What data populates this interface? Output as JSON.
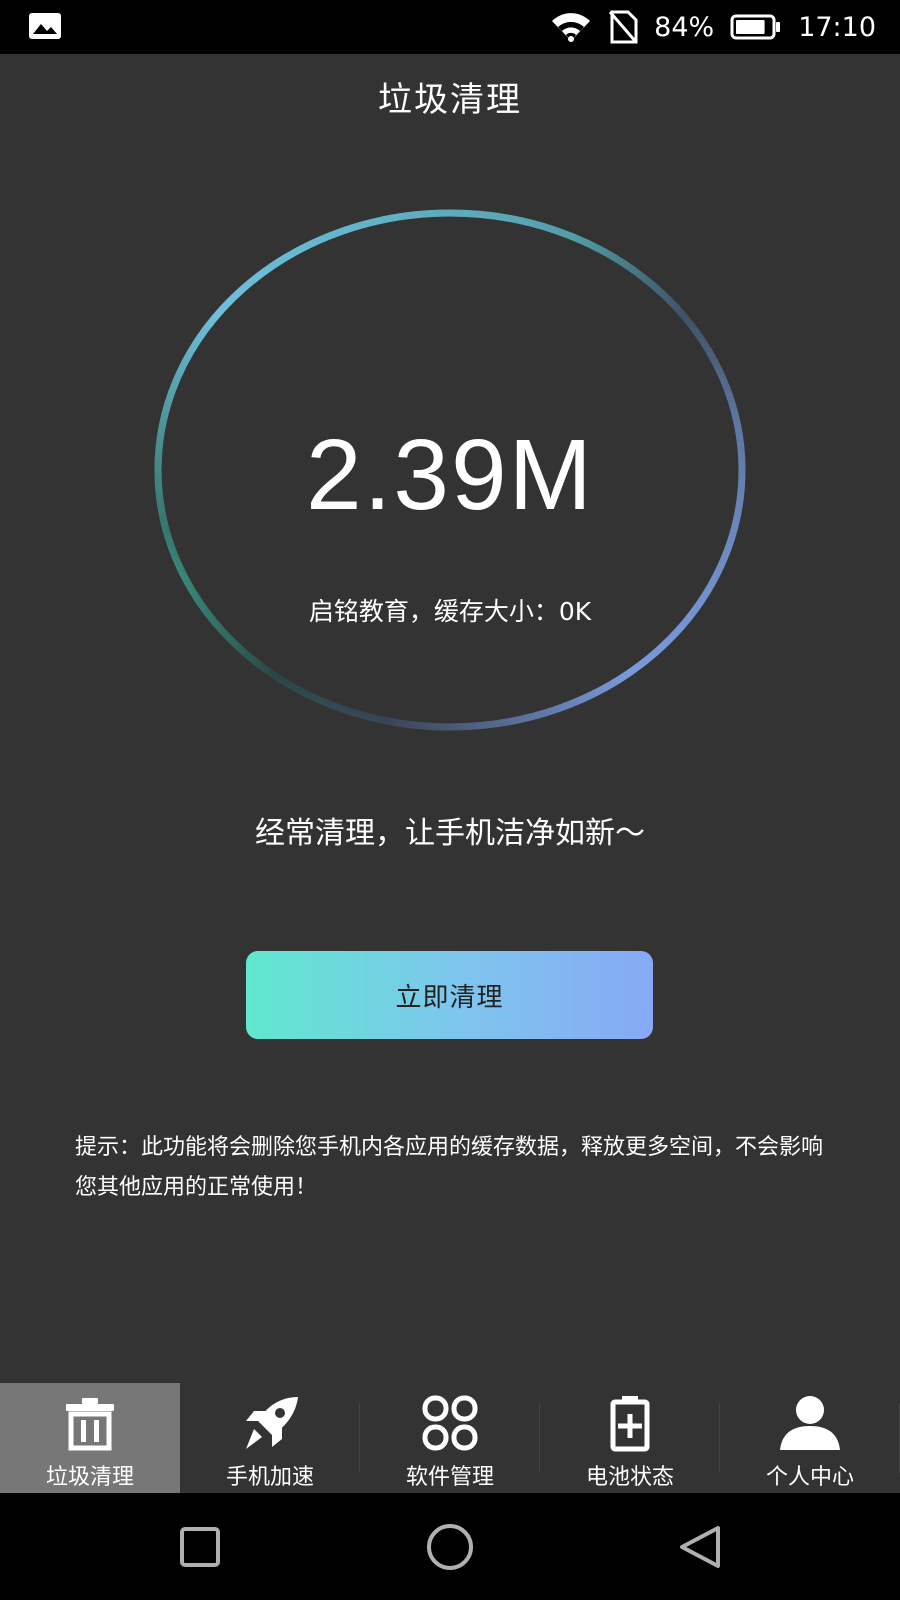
{
  "status_bar": {
    "battery_percent": "84%",
    "time": "17:10",
    "battery_level": 0.84
  },
  "page": {
    "title": "垃圾清理"
  },
  "scan": {
    "junk_size": "2.39M",
    "cache_info": "启铭教育，缓存大小：0K"
  },
  "slogan": "经常清理，让手机洁净如新～",
  "clean_button_label": "立即清理",
  "tip": "提示：此功能将会删除您手机内各应用的缓存数据，释放更多空间，不会影响您其他应用的正常使用！",
  "bottom_nav": {
    "items": [
      {
        "label": "垃圾清理",
        "icon": "trash-icon",
        "active": true
      },
      {
        "label": "手机加速",
        "icon": "rocket-icon",
        "active": false
      },
      {
        "label": "软件管理",
        "icon": "apps-grid-icon",
        "active": false
      },
      {
        "label": "电池状态",
        "icon": "battery-plus-icon",
        "active": false
      },
      {
        "label": "个人中心",
        "icon": "person-icon",
        "active": false
      }
    ]
  },
  "colors": {
    "background": "#333333",
    "ring_start": "#5fe8cf",
    "ring_end": "#86a9f5",
    "nav_active": "#777777"
  }
}
